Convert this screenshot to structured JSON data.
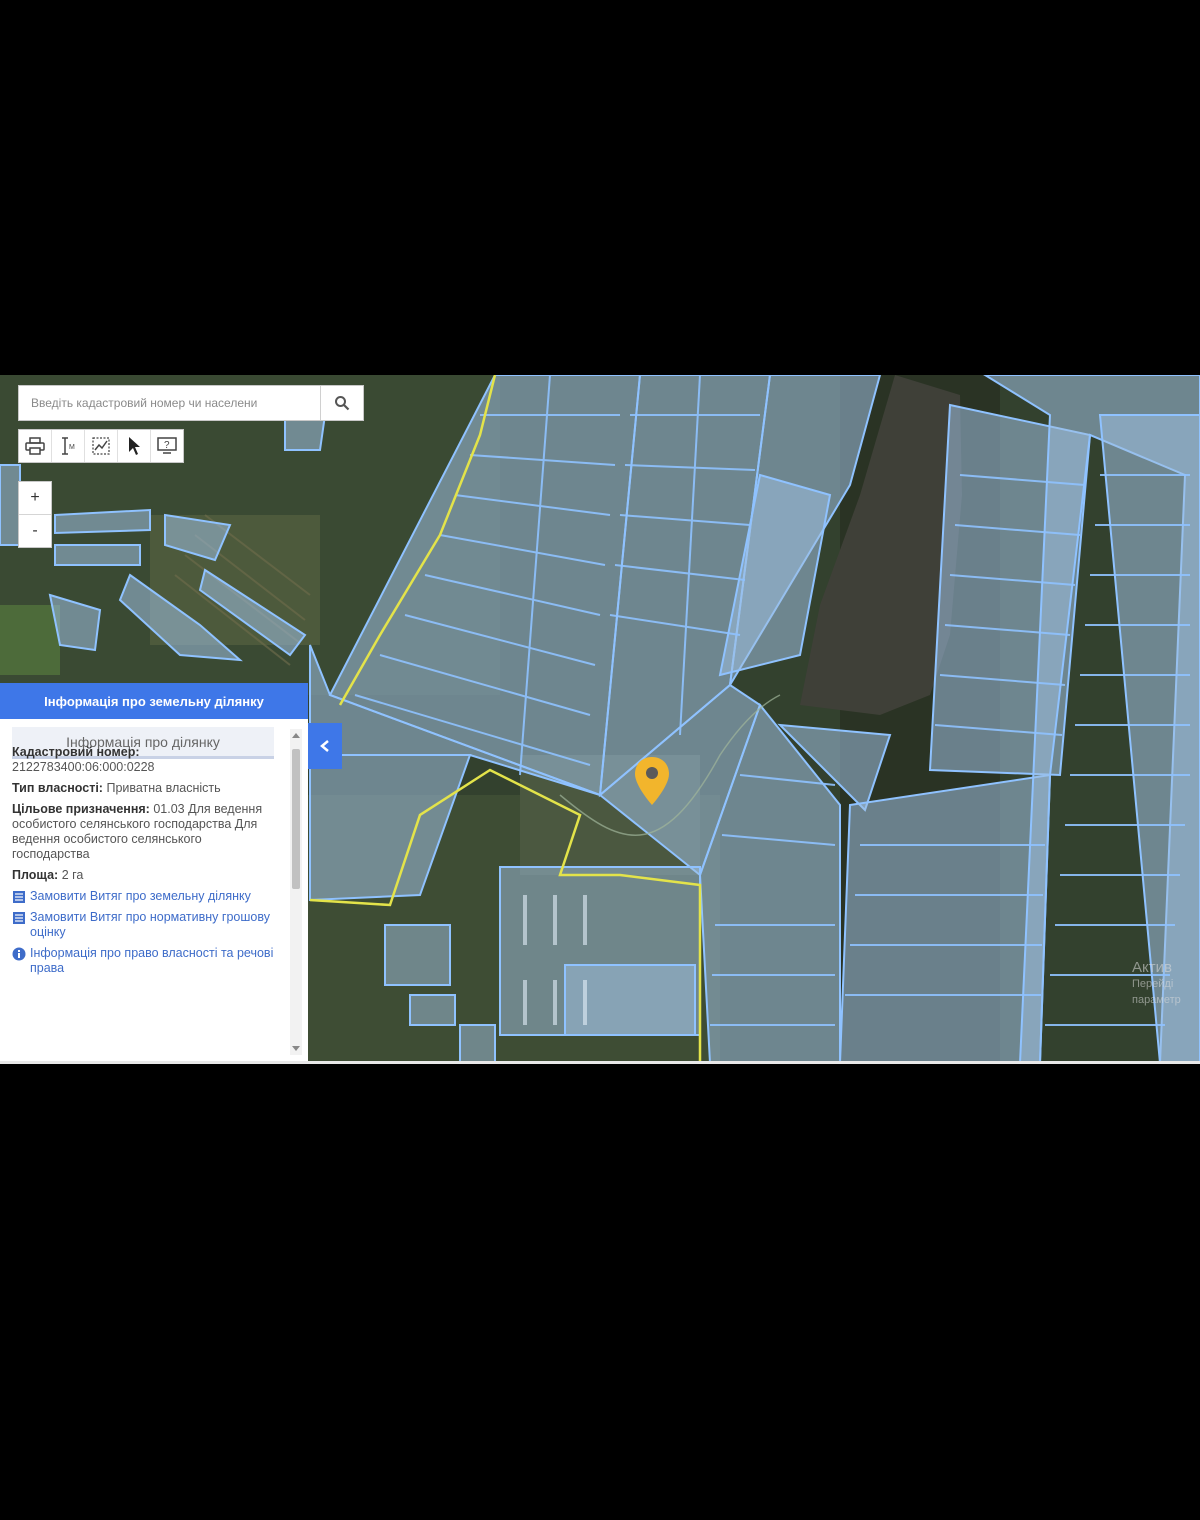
{
  "search": {
    "placeholder": "Введіть кадастровий номер чи населени"
  },
  "toolbar": {
    "icons": [
      "print-icon",
      "measure-distance-icon",
      "measure-area-icon",
      "pointer-icon",
      "help-icon"
    ]
  },
  "zoom": {
    "in_label": "+",
    "out_label": "-"
  },
  "panel": {
    "header": "Інформація про земельну ділянку",
    "subheader": "Інформація про ділянку",
    "cadastral_label": "Кадастровий номер:",
    "cadastral_value": "2122783400:06:000:0228",
    "ownership_label": "Тип власності:",
    "ownership_value": "Приватна власність",
    "purpose_label": "Цільове призначення:",
    "purpose_value": "01.03 Для ведення особистого селянського господарства Для ведення особистого селянського господарства",
    "area_label": "Площа:",
    "area_value": "2 га",
    "links": [
      {
        "icon": "document-icon",
        "label": "Замовити Витяг про земельну ділянку"
      },
      {
        "icon": "document-icon",
        "label": "Замовити Витяг про нормативну грошову оцінку"
      },
      {
        "icon": "info-icon",
        "label": "Інформація про право власності та речові права"
      }
    ]
  },
  "watermark": {
    "line1": "Актив",
    "line2": "Перейді",
    "line3": "параметр"
  },
  "colors": {
    "accent": "#3e77e8",
    "parcel_fill": "#a9c7e6",
    "parcel_stroke": "#8fc2ff",
    "boundary": "#e3e34a",
    "marker": "#f2b52c"
  }
}
